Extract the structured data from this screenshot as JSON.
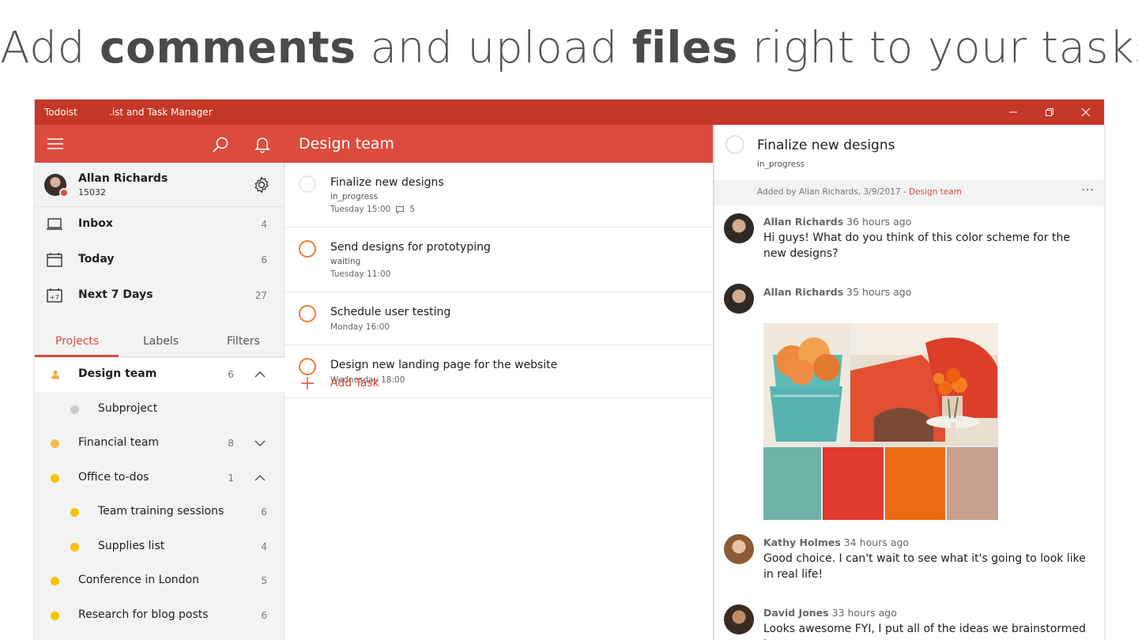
{
  "headline": {
    "part1": "Add ",
    "bold1": "comments",
    "part2": " and upload ",
    "bold2": "files",
    "part3": " right to your tasks"
  },
  "window": {
    "app_name": "Todoist",
    "subtitle": ".ist and Task Manager"
  },
  "user": {
    "name": "Allan Richards",
    "karma": "15032"
  },
  "nav": [
    {
      "label": "Inbox",
      "count": "4",
      "icon": "inbox-icon"
    },
    {
      "label": "Today",
      "count": "6",
      "icon": "calendar-today-icon"
    },
    {
      "label": "Next 7 Days",
      "count": "27",
      "icon": "calendar-week-icon"
    }
  ],
  "tabs": {
    "projects": "Projects",
    "labels": "Labels",
    "filters": "Filters"
  },
  "projects": [
    {
      "label": "Design team",
      "count": "6",
      "color": "#f0a73a",
      "indent": 0,
      "expand": "up",
      "selected": true,
      "shared": true
    },
    {
      "label": "Subproject",
      "count": "",
      "color": "#cccccc",
      "indent": 1
    },
    {
      "label": "Financial team",
      "count": "8",
      "color": "#f2bf4d",
      "indent": 0,
      "expand": "down"
    },
    {
      "label": "Office to-dos",
      "count": "1",
      "color": "#f5c400",
      "indent": 0,
      "expand": "up"
    },
    {
      "label": "Team training sessions",
      "count": "6",
      "color": "#f5c400",
      "indent": 1
    },
    {
      "label": "Supplies list",
      "count": "4",
      "color": "#f5c400",
      "indent": 1
    },
    {
      "label": "Conference in London",
      "count": "5",
      "color": "#f5c400",
      "indent": 0
    },
    {
      "label": "Research for blog posts",
      "count": "6",
      "color": "#f5c400",
      "indent": 0
    }
  ],
  "main": {
    "title": "Design team",
    "add_task": "Add Task",
    "tasks": [
      {
        "name": "Finalize new designs",
        "label": "in_progress",
        "date": "Tuesday 15:00",
        "comments": "5",
        "priority_color": "#e8e8e8"
      },
      {
        "name": "Send designs for prototyping",
        "label": "waiting",
        "date": "Tuesday 11:00",
        "priority_color": "#f07d2c"
      },
      {
        "name": "Schedule user testing",
        "date": "Monday 16:00",
        "priority_color": "#f07d2c"
      },
      {
        "name": "Design new landing page for the website",
        "date": "Wednesday 18:00",
        "priority_color": "#f07d2c"
      }
    ]
  },
  "detail": {
    "title": "Finalize new designs",
    "label": "in_progress",
    "added_by": "Added by Allan Richards, 3/9/2017 - ",
    "added_project": "Design team",
    "more": "···",
    "comments": [
      {
        "author": "Allan Richards",
        "time": "36 hours ago",
        "text": "Hi guys! What do you think of this color scheme for the new designs?"
      },
      {
        "author": "Allan Richards",
        "time": "35 hours ago",
        "text": ""
      },
      {
        "author": "Kathy Holmes",
        "time": "34 hours ago",
        "text": "Good choice. I can't wait to see what it's going to look like in real life!"
      },
      {
        "author": "David Jones",
        "time": "33 hours ago",
        "text": "Looks awesome FYI, I put all of the ideas we brainstormed last"
      }
    ],
    "swatches": [
      "#6fb2a6",
      "#df3a2c",
      "#eb6a14",
      "#c9a08d"
    ]
  }
}
